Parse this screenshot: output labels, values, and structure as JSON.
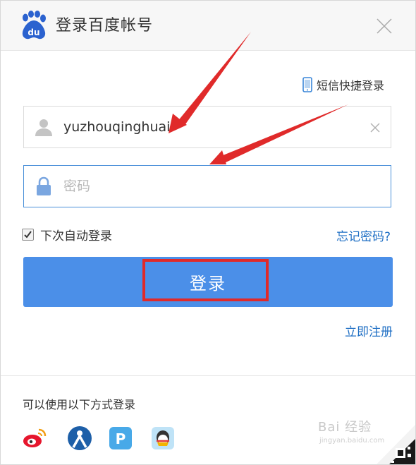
{
  "header": {
    "title": "登录百度帐号"
  },
  "sms_login": {
    "label": "短信快捷登录"
  },
  "username": {
    "value": "yuzhouqinghuai"
  },
  "password": {
    "placeholder": "密码"
  },
  "remember": {
    "label": "下次自动登录",
    "checked": true
  },
  "forgot_password": {
    "label": "忘记密码?"
  },
  "login_button": {
    "label": "登录"
  },
  "register": {
    "label": "立即注册"
  },
  "other_login": {
    "label": "可以使用以下方式登录"
  },
  "watermark": {
    "text": "Bai 经验",
    "url": "jingyan.baidu.com"
  },
  "colors": {
    "primary": "#4b8fe8",
    "link": "#1f6fc4",
    "annotation": "#e02a2a",
    "header_bg": "#f7f7f7"
  },
  "icons": [
    "baidu-logo",
    "close-icon",
    "phone-icon",
    "user-icon",
    "clear-icon",
    "lock-icon",
    "check-icon",
    "weibo-icon",
    "renren-icon",
    "pass-icon",
    "qq-icon"
  ]
}
